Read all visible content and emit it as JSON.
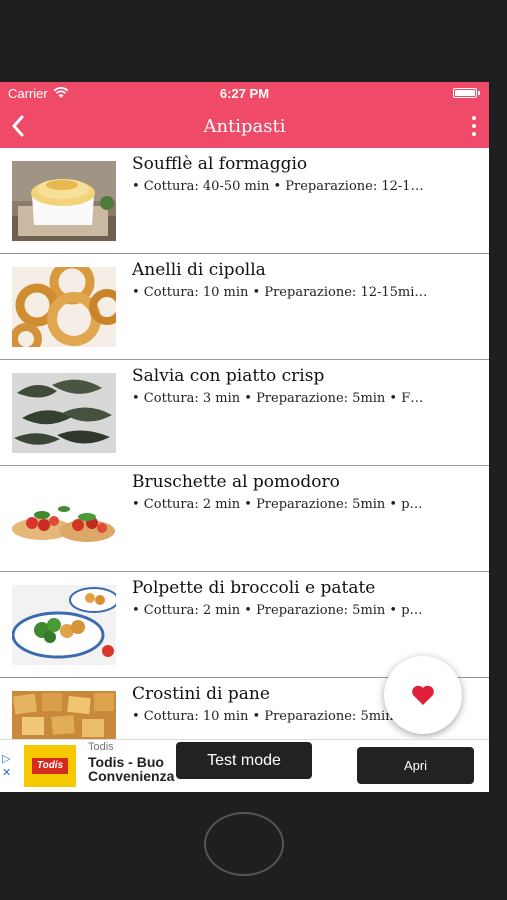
{
  "status_bar": {
    "carrier": "Carrier",
    "time": "6:27 PM"
  },
  "nav": {
    "title": "Antipasti",
    "back_icon": "chevron-left-icon",
    "menu_icon": "more-vertical-icon"
  },
  "recipes": [
    {
      "title": "Soufflè al formaggio",
      "meta": "• Cottura: 40-50 min  • Preparazione: 12-1…"
    },
    {
      "title": "Anelli di cipolla",
      "meta": "• Cottura: 10 min  • Preparazione: 12-15mi…"
    },
    {
      "title": "Salvia con piatto crisp",
      "meta": "• Cottura: 3 min  • Preparazione: 5min  •  F…"
    },
    {
      "title": "Bruschette al pomodoro",
      "meta": "• Cottura: 2 min  • Preparazione: 5min  •  p…"
    },
    {
      "title": "Polpette di broccoli e patate",
      "meta": "• Cottura: 2 min  • Preparazione: 5min  •  p…"
    },
    {
      "title": "Crostini di pane",
      "meta": "• Cottura: 10 min  • Preparazione: 5min  •  …"
    }
  ],
  "fab": {
    "icon": "heart-icon"
  },
  "ad": {
    "logo_text": "Todis",
    "advertiser": "Todis",
    "headline": "Todis - Buo Convenienza",
    "cta": "Apri"
  },
  "test_mode_label": "Test mode",
  "colors": {
    "primary": "#ef4b68",
    "heart": "#e0203a"
  }
}
